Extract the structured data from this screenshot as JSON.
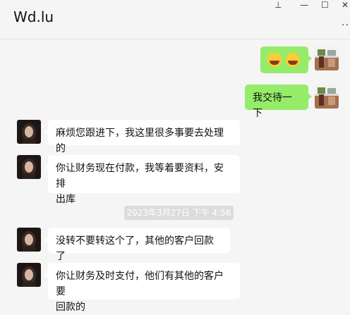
{
  "window": {
    "title": "Wd.lu",
    "pin_icon": "⊥",
    "minimize_icon": "—",
    "maximize_icon": "☐",
    "close_icon": "✕",
    "more_icon": "···"
  },
  "messages": [
    {
      "sender": "self",
      "type": "emoji",
      "emoji": [
        "tears-of-joy",
        "tears-of-joy"
      ]
    },
    {
      "sender": "self",
      "type": "text",
      "text": "我交待一下"
    },
    {
      "sender": "other",
      "type": "text",
      "text": "麻烦您跟进下，我这里很多事要去处理的"
    },
    {
      "sender": "other",
      "type": "text",
      "text_line1": "你让财务现在付款，我等着要资料，安排",
      "text_line2": "出库"
    },
    {
      "type": "timestamp",
      "text": "2023年3月27日 下午 4:56"
    },
    {
      "sender": "other",
      "type": "text",
      "text": "没转不要转这个了，其他的客户回款了"
    },
    {
      "sender": "other",
      "type": "text",
      "text_line1": "你让财务及时支付，他们有其他的客户要",
      "text_line2": "回款的"
    }
  ],
  "colors": {
    "self_bubble": "#95ec69",
    "other_bubble": "#ffffff",
    "background": "#f5f5f5"
  }
}
